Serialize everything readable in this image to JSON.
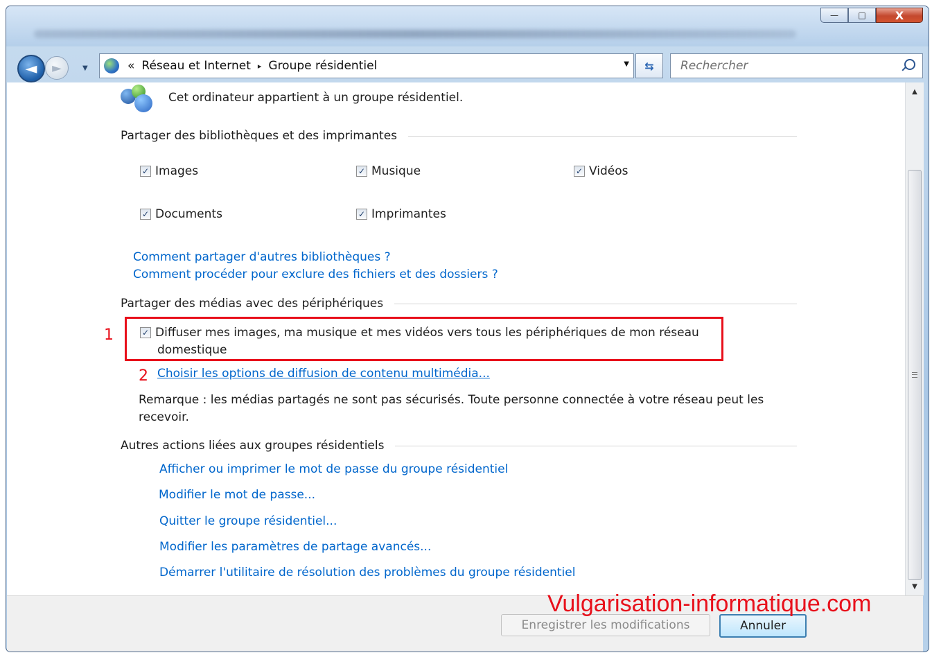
{
  "window": {
    "controls": {
      "minimize": "—",
      "maximize": "□",
      "close": "X"
    }
  },
  "navbar": {
    "back_icon": "back-arrow-icon",
    "forward_icon": "forward-arrow-icon",
    "breadcrumb": {
      "overflow": "«",
      "items": [
        "Réseau et Internet",
        "Groupe résidentiel"
      ],
      "separator": "▸"
    },
    "search_placeholder": "Rechercher"
  },
  "content": {
    "status_text": "Cet ordinateur appartient à un groupe résidentiel.",
    "share_section": {
      "heading": "Partager des bibliothèques et des imprimantes",
      "checkboxes": [
        {
          "label": "Images",
          "checked": true
        },
        {
          "label": "Musique",
          "checked": true
        },
        {
          "label": "Vidéos",
          "checked": true
        },
        {
          "label": "Documents",
          "checked": true
        },
        {
          "label": "Imprimantes",
          "checked": true
        }
      ],
      "links": [
        "Comment partager d'autres bibliothèques ?",
        "Comment procéder pour exclure des fichiers et des dossiers ?"
      ]
    },
    "media_section": {
      "heading": "Partager des médias avec des périphériques",
      "marker_1": "1",
      "marker_2": "2",
      "stream_checkbox": {
        "line1": "Diffuser mes images, ma musique et mes vidéos vers tous les périphériques de mon réseau",
        "line2": "domestique",
        "checked": true
      },
      "options_link": "Choisir les options de diffusion de contenu multimédia...",
      "note_line1": "Remarque : les médias partagés ne sont pas sécurisés. Toute personne connectée à votre réseau peut les",
      "note_line2": "recevoir."
    },
    "other_section": {
      "heading": "Autres actions liées aux groupes résidentiels",
      "links": [
        "Afficher ou imprimer le mot de passe du groupe résidentiel",
        "Modifier le mot de passe...",
        "Quitter le groupe résidentiel...",
        "Modifier les paramètres de partage avancés...",
        "Démarrer l'utilitaire de résolution des problèmes du groupe résidentiel"
      ]
    }
  },
  "footer": {
    "save_label": "Enregistrer les modifications",
    "cancel_label": "Annuler"
  },
  "watermark": "Vulgarisation-informatique.com",
  "colors": {
    "link": "#0066cc",
    "annotation_red": "#e8101b"
  }
}
